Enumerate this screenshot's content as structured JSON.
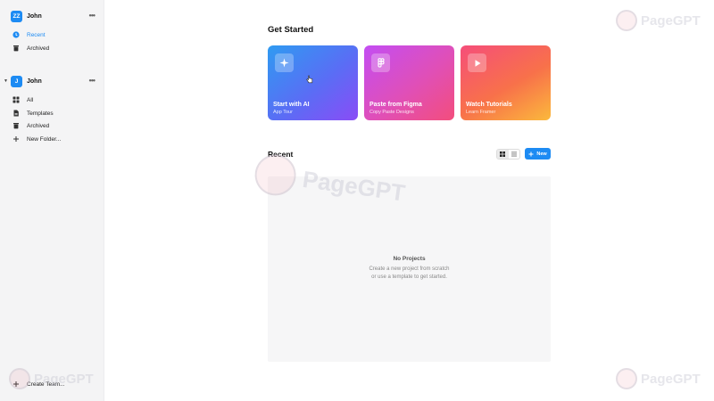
{
  "sidebar": {
    "personal": {
      "avatar_initials": "ZZ",
      "name": "John",
      "more_icon": "more-dots-icon"
    },
    "personal_items": [
      {
        "label": "Recent",
        "icon": "clock-icon",
        "active": true
      },
      {
        "label": "Archived",
        "icon": "trash-icon",
        "active": false
      }
    ],
    "team": {
      "avatar_initials": "J",
      "name": "John",
      "more_icon": "more-dots-icon"
    },
    "team_items": [
      {
        "label": "All",
        "icon": "grid-icon"
      },
      {
        "label": "Templates",
        "icon": "file-icon"
      },
      {
        "label": "Archived",
        "icon": "trash-icon"
      },
      {
        "label": "New Folder...",
        "icon": "plus-icon"
      }
    ],
    "create_team": "Create Team..."
  },
  "main": {
    "get_started_title": "Get Started",
    "cards": [
      {
        "title": "Start with AI",
        "subtitle": "App Tour",
        "icon": "sparkle-icon"
      },
      {
        "title": "Paste from Figma",
        "subtitle": "Copy Paste Designs",
        "icon": "figma-icon"
      },
      {
        "title": "Watch Tutorials",
        "subtitle": "Learn Framer",
        "icon": "play-icon"
      }
    ],
    "recent_title": "Recent",
    "new_button": "New",
    "empty_title": "No Projects",
    "empty_desc_line1": "Create a new project from scratch",
    "empty_desc_line2": "or use a template to get started."
  },
  "watermark": "PageGPT",
  "colors": {
    "accent": "#1d8bf3",
    "sidebar_bg": "#f4f4f5",
    "empty_bg": "#f6f6f7"
  }
}
